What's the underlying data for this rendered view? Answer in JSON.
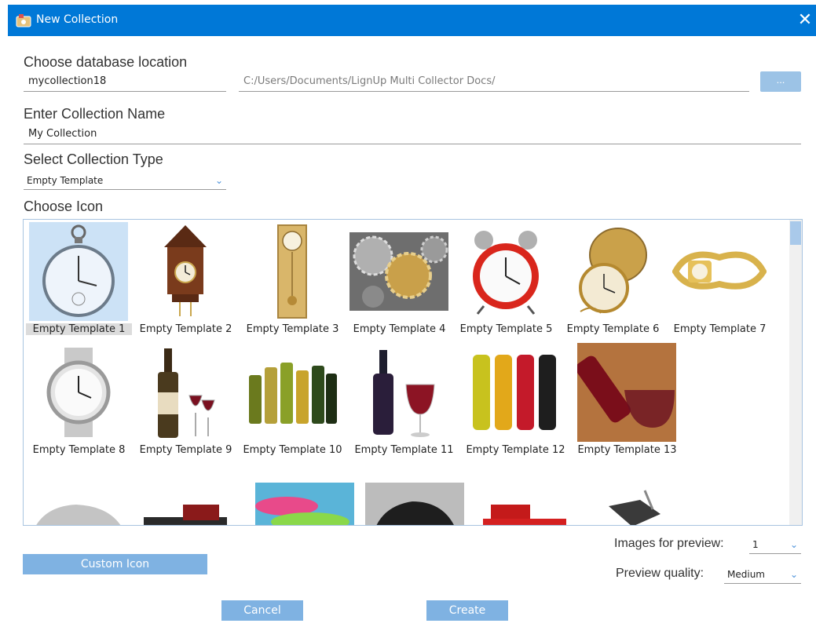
{
  "window": {
    "title": "New Collection"
  },
  "database": {
    "label": "Choose database location",
    "filename": "mycollection18",
    "path": "C:/Users/Documents/LignUp Multi Collector Docs/",
    "browse_label": "..."
  },
  "name": {
    "label": "Enter Collection Name",
    "value": "My Collection"
  },
  "type": {
    "label": "Select Collection Type",
    "value": "Empty Template"
  },
  "icons": {
    "label": "Choose Icon",
    "items": [
      {
        "caption": "Empty Template 1",
        "icon": "pocket-watch-icon"
      },
      {
        "caption": "Empty Template 2",
        "icon": "cuckoo-clock-icon"
      },
      {
        "caption": "Empty Template 3",
        "icon": "pendulum-clock-icon"
      },
      {
        "caption": "Empty Template 4",
        "icon": "gears-icon"
      },
      {
        "caption": "Empty Template 5",
        "icon": "alarm-clock-icon"
      },
      {
        "caption": "Empty Template 6",
        "icon": "gold-pocket-watch-icon"
      },
      {
        "caption": "Empty Template 7",
        "icon": "gold-wristwatch-icon"
      },
      {
        "caption": "Empty Template 8",
        "icon": "silver-wristwatch-icon"
      },
      {
        "caption": "Empty Template 9",
        "icon": "wine-bottle-glasses-icon"
      },
      {
        "caption": "Empty Template 10",
        "icon": "wine-bottles-icon"
      },
      {
        "caption": "Empty Template 11",
        "icon": "red-wine-glass-icon"
      },
      {
        "caption": "Empty Template 12",
        "icon": "colored-bottles-icon"
      },
      {
        "caption": "Empty Template 13",
        "icon": "pouring-wine-icon"
      },
      {
        "caption": "",
        "icon": "silver-car-icon"
      },
      {
        "caption": "",
        "icon": "vintage-car-icon"
      },
      {
        "caption": "",
        "icon": "colorful-cars-icon"
      },
      {
        "caption": "",
        "icon": "black-classic-car-icon"
      },
      {
        "caption": "",
        "icon": "red-hot-rod-icon"
      },
      {
        "caption": "",
        "icon": "motorcycle-icon"
      }
    ]
  },
  "preview": {
    "images_label": "Images for preview:",
    "images_value": "1",
    "quality_label": "Preview quality:",
    "quality_value": "Medium"
  },
  "buttons": {
    "custom_icon": "Custom Icon",
    "cancel": "Cancel",
    "create": "Create"
  },
  "colors": {
    "titlebar": "#0078d7",
    "button": "#7fb2e2",
    "selection": "#cce2f6"
  }
}
